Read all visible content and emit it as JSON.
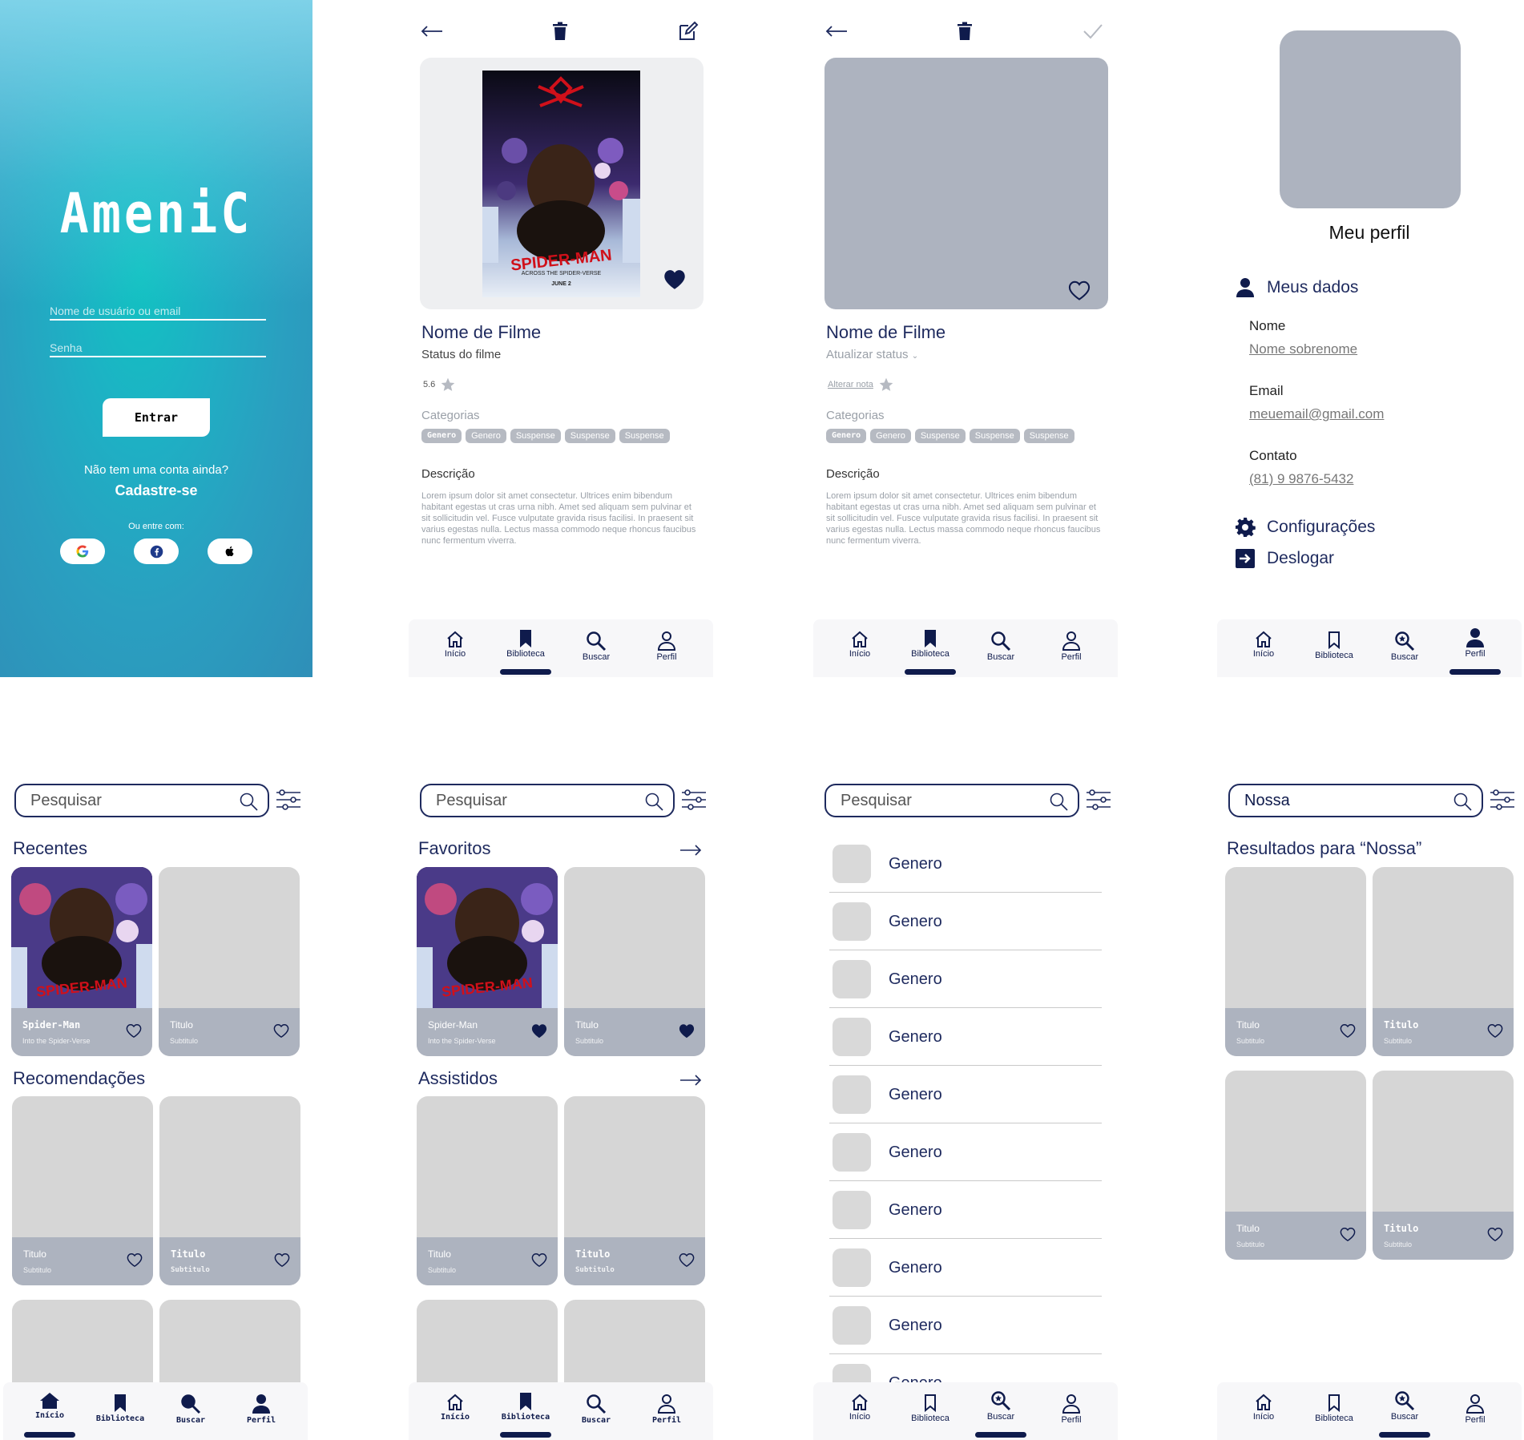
{
  "colors": {
    "navy": "#0f1b4c",
    "teal": "#12c2c2",
    "placeholder_grey": "#adb3bf",
    "card_grey": "#d6d6d6"
  },
  "login": {
    "logo": "AmeniC",
    "username_placeholder": "Nome de usuário ou email",
    "password_placeholder": "Senha",
    "submit_label": "Entrar",
    "no_account": "Não tem uma conta ainda?",
    "signup": "Cadastre-se",
    "or_with": "Ou entre com:",
    "social": [
      "google-icon",
      "facebook-icon",
      "apple-icon"
    ]
  },
  "detail": {
    "title": "Nome de Filme",
    "status": "Status do filme",
    "rating": "5.6",
    "categories_label": "Categorias",
    "chips": [
      "Genero",
      "Genero",
      "Suspense",
      "Suspense",
      "Suspense"
    ],
    "description_label": "Descrição",
    "description": "Lorem ipsum dolor sit amet consectetur. Ultrices enim bibendum habitant egestas ut cras urna nibh. Amet sed aliquam sem pulvinar et sit sollicitudin vel. Fusce vulputate gravida risus facilisi. In praesent sit varius egestas nulla. Lectus massa commodo neque rhoncus faucibus nunc fermentum viverra.",
    "poster_text": "SPIDER-MAN",
    "poster_subtext": "ACROSS THE SPIDER-VERSE",
    "poster_date": "JUNE 2"
  },
  "edit": {
    "title": "Nome de Filme",
    "status": "Atualizar status",
    "rate_link": "Alterar nota",
    "categories_label": "Categorias",
    "chips": [
      "Genero",
      "Genero",
      "Suspense",
      "Suspense",
      "Suspense"
    ],
    "description_label": "Descrição",
    "description": "Lorem ipsum dolor sit amet consectetur. Ultrices enim bibendum habitant egestas ut cras urna nibh. Amet sed aliquam sem pulvinar et sit sollicitudin vel. Fusce vulputate gravida risus facilisi. In praesent sit varius egestas nulla. Lectus massa commodo neque rhoncus faucibus nunc fermentum viverra."
  },
  "profile": {
    "title": "Meu perfil",
    "my_data": "Meus dados",
    "name_label": "Nome",
    "name_value": "Nome sobrenome",
    "email_label": "Email",
    "email_value": "meuemail@gmail.com",
    "contact_label": "Contato",
    "contact_value": "(81) 9 9876-5432",
    "settings": "Configurações",
    "logout": "Deslogar"
  },
  "nav": {
    "home": "Início",
    "library": "Biblioteca",
    "search": "Buscar",
    "profile": "Perfil"
  },
  "home": {
    "search_placeholder": "Pesquisar",
    "recent_title": "Recentes",
    "recommend_title": "Recomendações",
    "card_spider_title": "Spider-Man",
    "card_spider_sub": "Into the Spider-Verse",
    "card_title": "Titulo",
    "card_sub": "Subtitulo"
  },
  "library": {
    "search_placeholder": "Pesquisar",
    "favorites_title": "Favoritos",
    "watched_title": "Assistidos"
  },
  "genres": {
    "search_placeholder": "Pesquisar",
    "items": [
      "Genero",
      "Genero",
      "Genero",
      "Genero",
      "Genero",
      "Genero",
      "Genero",
      "Genero",
      "Genero",
      "Genero"
    ]
  },
  "results": {
    "query": "Nossa",
    "title": "Resultados para “Nossa”"
  }
}
